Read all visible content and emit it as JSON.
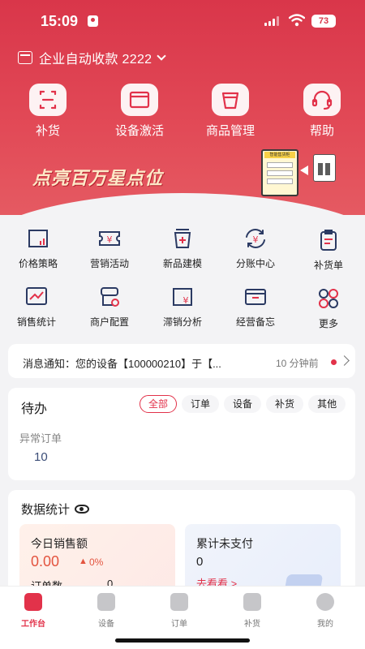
{
  "status_bar": {
    "time": "15:09",
    "battery": "73"
  },
  "header": {
    "account_name": "企业自动收款 2222"
  },
  "quick_actions": [
    {
      "label": "补货",
      "icon": "scan-icon"
    },
    {
      "label": "设备激活",
      "icon": "card-icon"
    },
    {
      "label": "商品管理",
      "icon": "cup-icon"
    },
    {
      "label": "帮助",
      "icon": "headset-icon"
    }
  ],
  "banner": {
    "text": "点亮百万星点位",
    "sign_text": "智能售货柜"
  },
  "functions": [
    {
      "label": "价格策略",
      "icon": "price-chart-icon"
    },
    {
      "label": "营销活动",
      "icon": "yen-coupon-icon"
    },
    {
      "label": "新品建模",
      "icon": "new-product-icon"
    },
    {
      "label": "分账中心",
      "icon": "yen-cycle-icon"
    },
    {
      "label": "补货单",
      "icon": "clipboard-icon"
    },
    {
      "label": "销售统计",
      "icon": "sales-chart-icon"
    },
    {
      "label": "商户配置",
      "icon": "merchant-config-icon"
    },
    {
      "label": "滞销分析",
      "icon": "slow-sales-icon"
    },
    {
      "label": "经营备忘",
      "icon": "memo-box-icon"
    },
    {
      "label": "更多",
      "icon": "more-icon"
    }
  ],
  "notice": {
    "text": "消息通知：您的设备【100000210】于【...",
    "time_ago": "10 分钟前"
  },
  "todo": {
    "title": "待办",
    "filters": [
      "全部",
      "订单",
      "设备",
      "补货",
      "其他"
    ],
    "active_filter": "全部",
    "item_label": "异常订单",
    "item_value": "10"
  },
  "stats": {
    "title": "数据统计",
    "today_sales_label": "今日销售额",
    "today_sales_value": "0.00",
    "today_sales_change": "0%",
    "order_count_label": "订单数",
    "order_count_value": "0",
    "unpaid_label": "累计未支付",
    "unpaid_value": "0",
    "unpaid_link": "去看看 >"
  },
  "tabbar": [
    {
      "label": "工作台",
      "icon": "workbench-icon",
      "active": true
    },
    {
      "label": "设备",
      "icon": "device-icon",
      "active": false
    },
    {
      "label": "订单",
      "icon": "order-icon",
      "active": false
    },
    {
      "label": "补货",
      "icon": "restock-truck-icon",
      "active": false
    },
    {
      "label": "我的",
      "icon": "profile-icon",
      "active": false
    }
  ],
  "colors": {
    "brand_red": "#e2324a",
    "header_red": "#d9364a",
    "link_blue": "#3c4e78"
  }
}
